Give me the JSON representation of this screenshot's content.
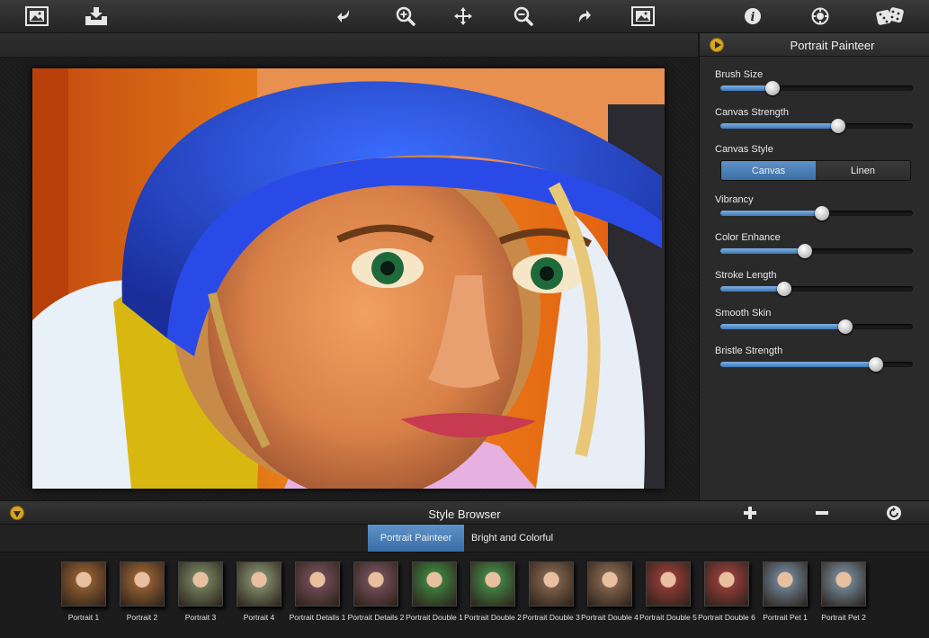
{
  "toolbar": {
    "items": [
      {
        "icon": "open-image-icon"
      },
      {
        "icon": "save-icon"
      },
      {
        "icon": "undo-icon"
      },
      {
        "icon": "zoom-in-icon"
      },
      {
        "icon": "pan-icon"
      },
      {
        "icon": "zoom-out-icon"
      },
      {
        "icon": "redo-icon"
      },
      {
        "icon": "fit-image-icon"
      },
      {
        "icon": "info-icon"
      },
      {
        "icon": "settings-icon"
      },
      {
        "icon": "random-dice-icon"
      }
    ]
  },
  "panel": {
    "title": "Portrait Painteer",
    "controls": [
      {
        "label": "Brush Size",
        "value": 0.27
      },
      {
        "label": "Canvas Strength",
        "value": 0.61
      },
      {
        "label": "Canvas Style",
        "options": [
          "Canvas",
          "Linen"
        ],
        "selected": "Canvas"
      },
      {
        "label": "Vibrancy",
        "value": 0.53
      },
      {
        "label": "Color Enhance",
        "value": 0.44
      },
      {
        "label": "Stroke Length",
        "value": 0.33
      },
      {
        "label": "Smooth Skin",
        "value": 0.65
      },
      {
        "label": "Bristle Strength",
        "value": 0.81
      }
    ]
  },
  "style_browser": {
    "title": "Style Browser",
    "tabs": [
      {
        "label": "Portrait Painteer",
        "active": true
      },
      {
        "label": "Bright and Colorful",
        "active": false
      }
    ],
    "thumbnails": [
      {
        "label": "Portrait 1",
        "color": "#8a5a30"
      },
      {
        "label": "Portrait 2",
        "color": "#8d5c33"
      },
      {
        "label": "Portrait 3",
        "color": "#6e7a5a"
      },
      {
        "label": "Portrait 4",
        "color": "#7a8466"
      },
      {
        "label": "Portrait Details 1",
        "color": "#6b4a52"
      },
      {
        "label": "Portrait Details 2",
        "color": "#6e4c54"
      },
      {
        "label": "Portrait Double 1",
        "color": "#3e7a3e"
      },
      {
        "label": "Portrait Double 2",
        "color": "#427e44"
      },
      {
        "label": "Portrait Double 3",
        "color": "#7a5e4a"
      },
      {
        "label": "Portrait Double 4",
        "color": "#7e624c"
      },
      {
        "label": "Portrait Double 5",
        "color": "#8a3a36"
      },
      {
        "label": "Portrait Double 6",
        "color": "#8c3c38"
      },
      {
        "label": "Portrait Pet 1",
        "color": "#6a7c8c"
      },
      {
        "label": "Portrait Pet 2",
        "color": "#6e808e"
      }
    ]
  },
  "colors": {
    "accent": "#4a80bc",
    "gold": "#d9a520"
  }
}
